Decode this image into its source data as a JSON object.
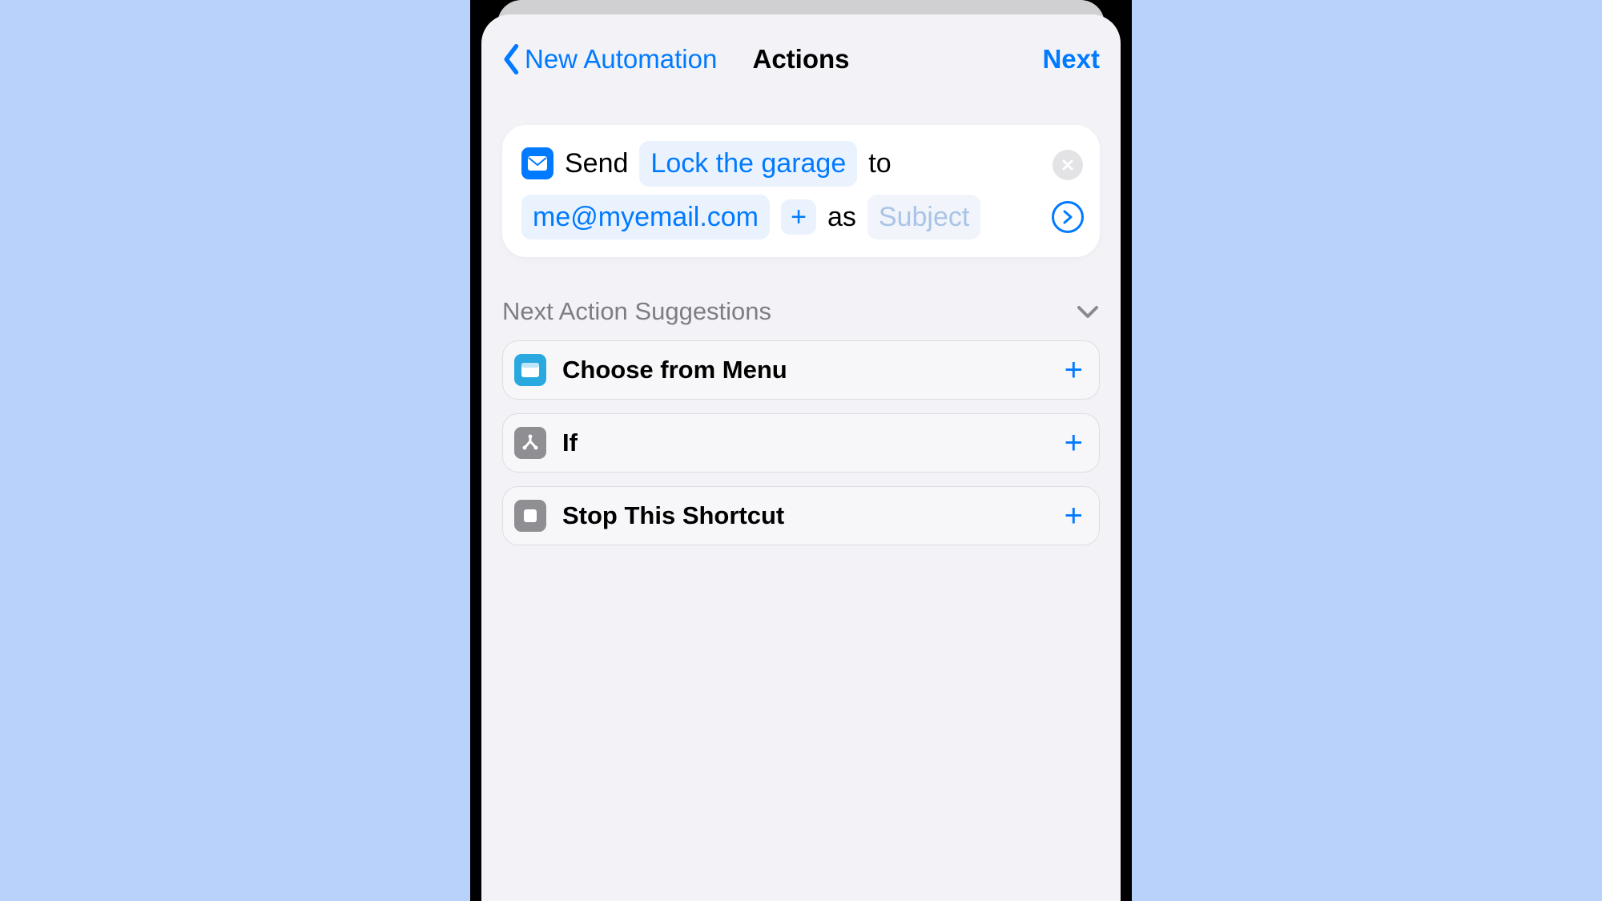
{
  "nav": {
    "back_label": "New Automation",
    "title": "Actions",
    "next_label": "Next"
  },
  "action": {
    "verb_send": "Send",
    "message_token": "Lock the garage",
    "word_to": "to",
    "recipient_token": "me@myemail.com",
    "word_as": "as",
    "subject_placeholder": "Subject"
  },
  "suggestions_header": "Next Action Suggestions",
  "suggestions": [
    {
      "label": "Choose from Menu",
      "icon": "menu"
    },
    {
      "label": "If",
      "icon": "if"
    },
    {
      "label": "Stop This Shortcut",
      "icon": "stop"
    }
  ]
}
